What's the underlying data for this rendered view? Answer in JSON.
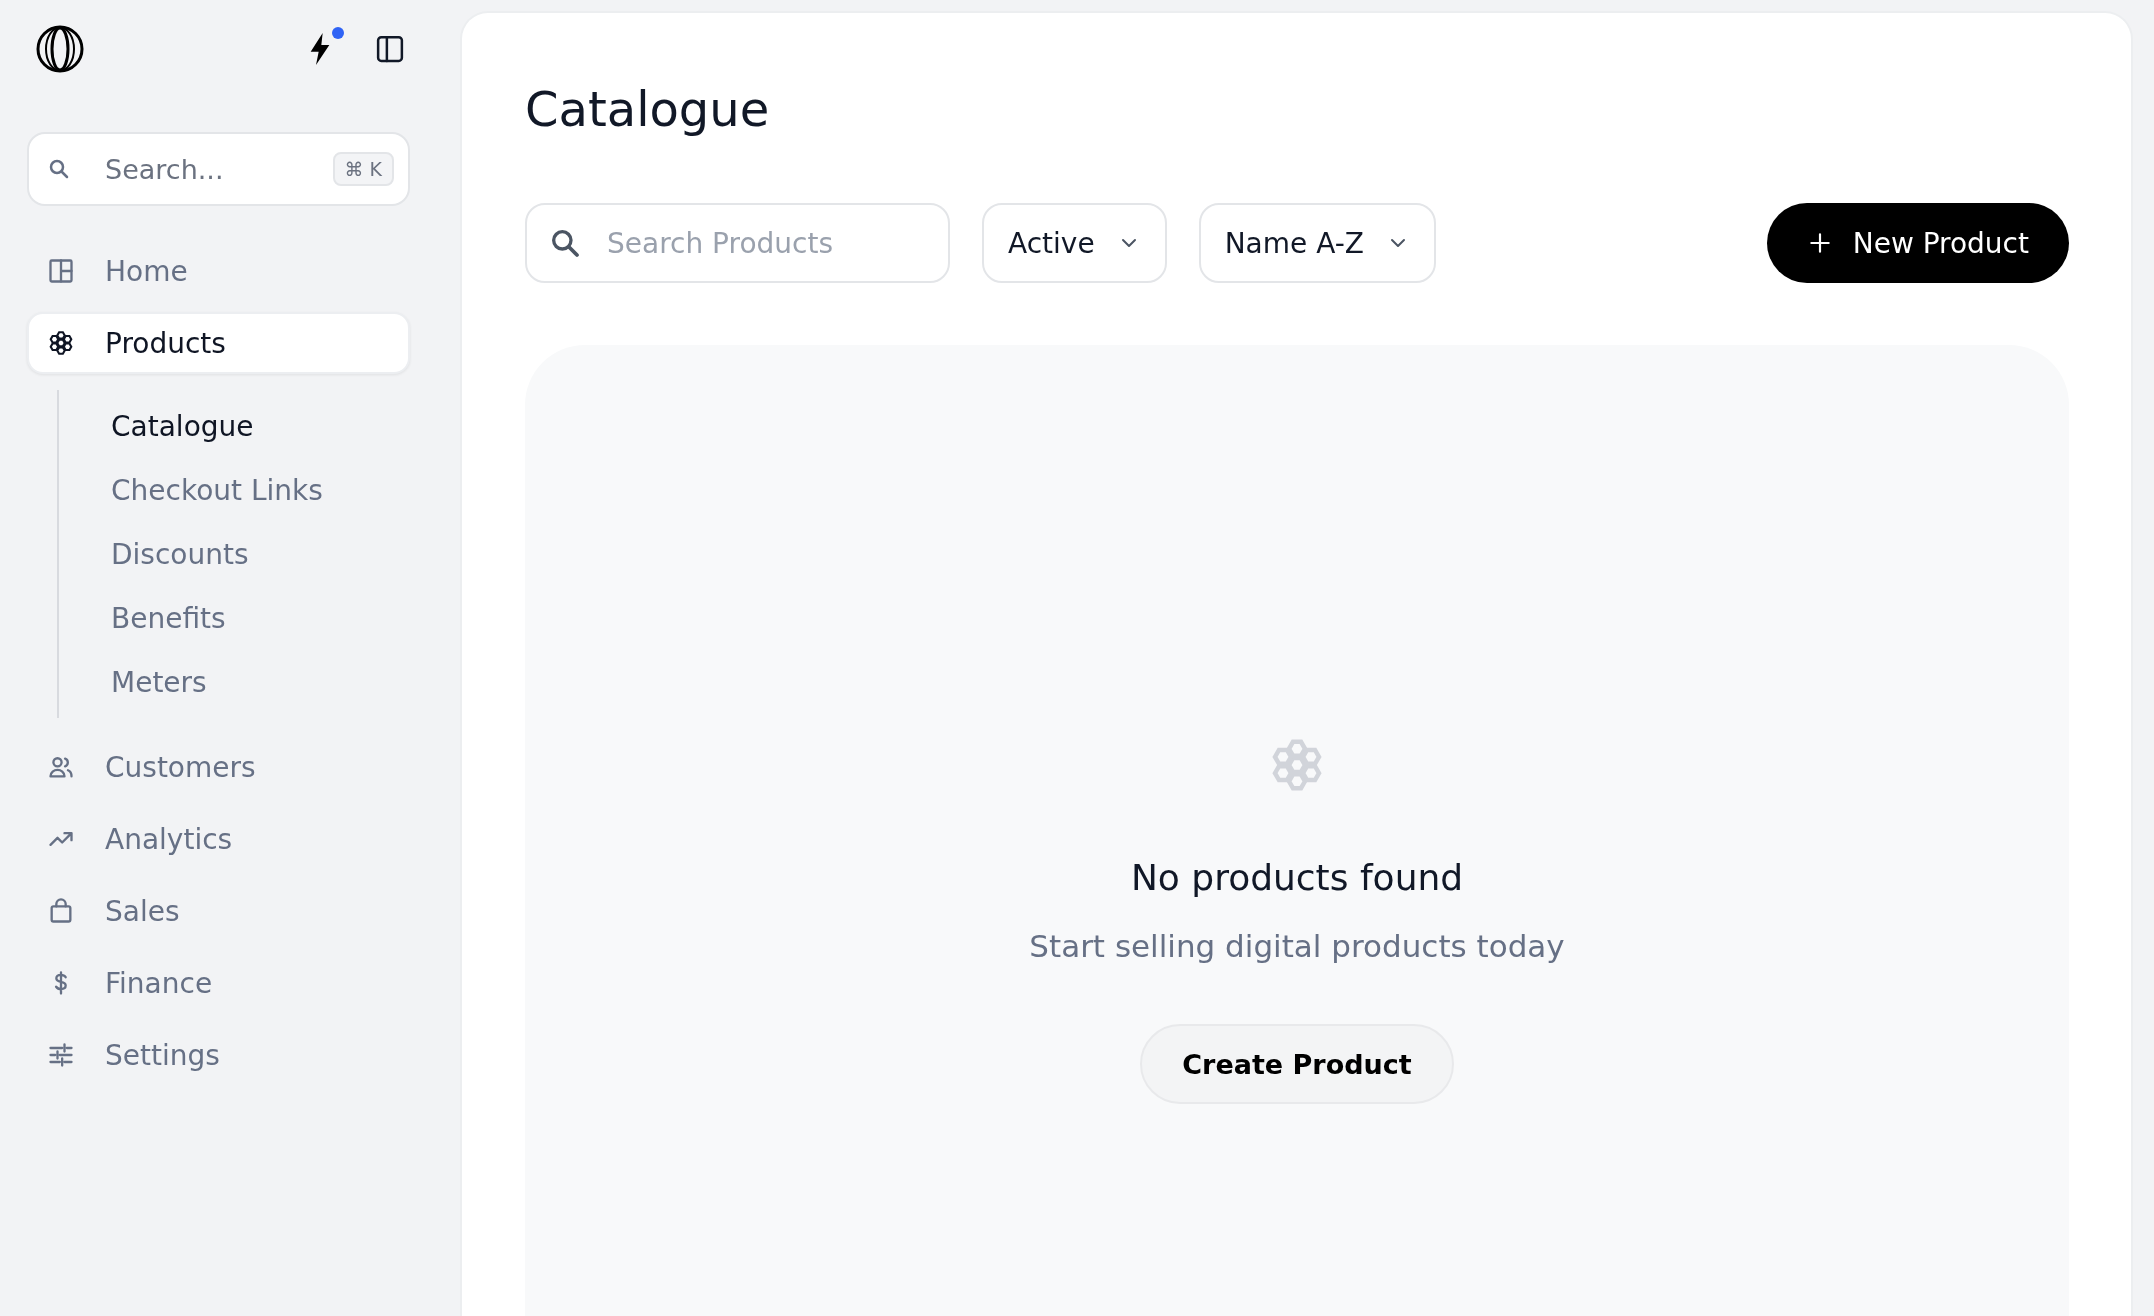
{
  "sidebar": {
    "notification_dot": true,
    "search": {
      "placeholder": "Search...",
      "shortcut": "⌘ K"
    },
    "items": [
      {
        "label": "Home",
        "selected": false
      },
      {
        "label": "Products",
        "selected": true,
        "expanded": true,
        "children": [
          {
            "label": "Catalogue",
            "selected": true
          },
          {
            "label": "Checkout Links",
            "selected": false
          },
          {
            "label": "Discounts",
            "selected": false
          },
          {
            "label": "Benefits",
            "selected": false
          },
          {
            "label": "Meters",
            "selected": false
          }
        ]
      },
      {
        "label": "Customers",
        "selected": false
      },
      {
        "label": "Analytics",
        "selected": false
      },
      {
        "label": "Sales",
        "selected": false
      },
      {
        "label": "Finance",
        "selected": false
      },
      {
        "label": "Settings",
        "selected": false
      }
    ]
  },
  "main": {
    "title": "Catalogue",
    "toolbar": {
      "search": {
        "placeholder": "Search Products"
      },
      "filters": [
        {
          "label": "Active"
        },
        {
          "label": "Name A-Z"
        }
      ],
      "new_button": {
        "label": "New Product"
      }
    },
    "empty_state": {
      "title": "No products found",
      "subtitle": "Start selling digital products today",
      "button": {
        "label": "Create Product"
      }
    }
  }
}
